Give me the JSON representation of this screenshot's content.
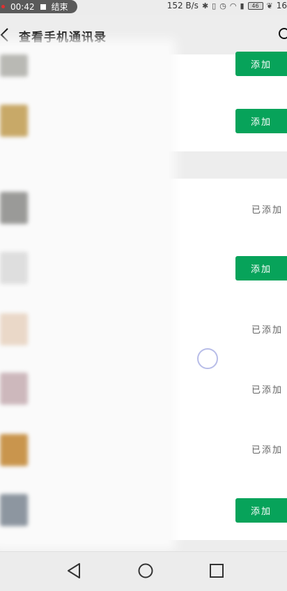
{
  "status_bar": {
    "time": "00:42",
    "end_label": "结束",
    "net_speed": "152 B/s",
    "battery": "46",
    "clock_tail": "16"
  },
  "header": {
    "title": "查看手机通讯录"
  },
  "rows": [
    {
      "action": "add",
      "label": "添加"
    },
    {
      "action": "add",
      "label": "添加"
    },
    {
      "action": "added",
      "label": "已添加"
    },
    {
      "action": "add",
      "label": "添加"
    },
    {
      "action": "added",
      "label": "已添加"
    },
    {
      "action": "added",
      "label": "已添加"
    },
    {
      "action": "added",
      "label": "已添加"
    },
    {
      "action": "add",
      "label": "添加"
    }
  ],
  "colors": {
    "accent": "#07a35a",
    "background": "#ededed"
  }
}
